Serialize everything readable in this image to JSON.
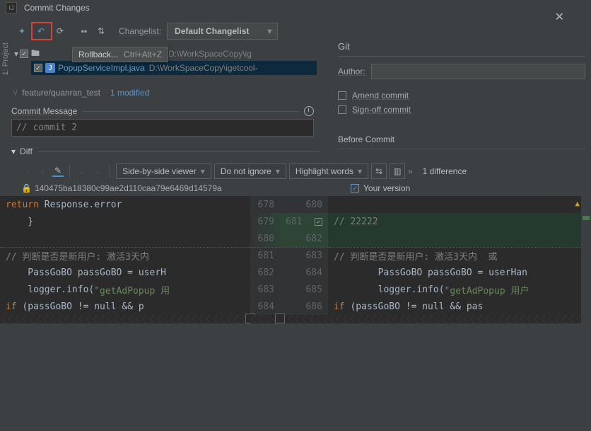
{
  "window": {
    "title": "Commit Changes",
    "sidebar_tab": "1: Project"
  },
  "toolbar": {
    "changelist_label": "Changelist:",
    "changelist_value": "Default Changelist"
  },
  "tooltip": {
    "label": "Rollback...",
    "shortcut": "Ctrl+Alt+Z"
  },
  "tree": {
    "root_suffix": "ter  1 file  D:\\WorkSpaceCopy\\ig",
    "file_name": "PopupServiceImpl.java",
    "file_path": "D:\\WorkSpaceCopy\\igetcool-"
  },
  "branch": {
    "name": "feature/quanran_test",
    "modified": "1 modified"
  },
  "commit": {
    "section_label": "Commit Message",
    "message": "// commit 2"
  },
  "diff": {
    "label": "Diff",
    "viewer": "Side-by-side viewer",
    "whitespace": "Do not ignore",
    "highlight": "Highlight words",
    "count": "1 difference",
    "left_label": "140475ba18380c99ae2d110caa79e6469d14579a",
    "right_label": "Your version"
  },
  "gutter": {
    "left": [
      "678",
      "679",
      "680",
      "681",
      "682",
      "683",
      "684"
    ],
    "right": [
      "680",
      "681",
      "682",
      "683",
      "684",
      "685",
      "686"
    ]
  },
  "code": {
    "left": [
      {
        "pre": "        ",
        "kw": "return",
        "post": " Response.error"
      },
      {
        "pre": "    }",
        "kw": "",
        "post": ""
      },
      {
        "pre": "",
        "kw": "",
        "post": ""
      },
      {
        "pre": "    ",
        "com": "// 判断是否是新用户: 激活3天内"
      },
      {
        "pre": "    PassGoBO passGoBO = userH"
      },
      {
        "pre": "    logger.info(",
        "str": "\"getAdPopup 用"
      },
      {
        "pre": "    ",
        "kw": "if",
        "post": " (passGoBO != null && p"
      }
    ],
    "right": [
      {
        "pre": ""
      },
      {
        "pre": "        ",
        "com": "// 22222"
      },
      {
        "pre": ""
      },
      {
        "pre": "        ",
        "com": "// 判断是否是新用户: 激活3天内  或"
      },
      {
        "pre": "        PassGoBO passGoBO = userHan"
      },
      {
        "pre": "        logger.info(",
        "str": "\"getAdPopup 用户"
      },
      {
        "pre": "        ",
        "kw": "if",
        "post": " (passGoBO != null && pas"
      }
    ]
  },
  "git": {
    "label": "Git",
    "author_label": "Author:",
    "amend": "Amend commit",
    "signoff": "Sign-off commit",
    "before": "Before Commit"
  }
}
